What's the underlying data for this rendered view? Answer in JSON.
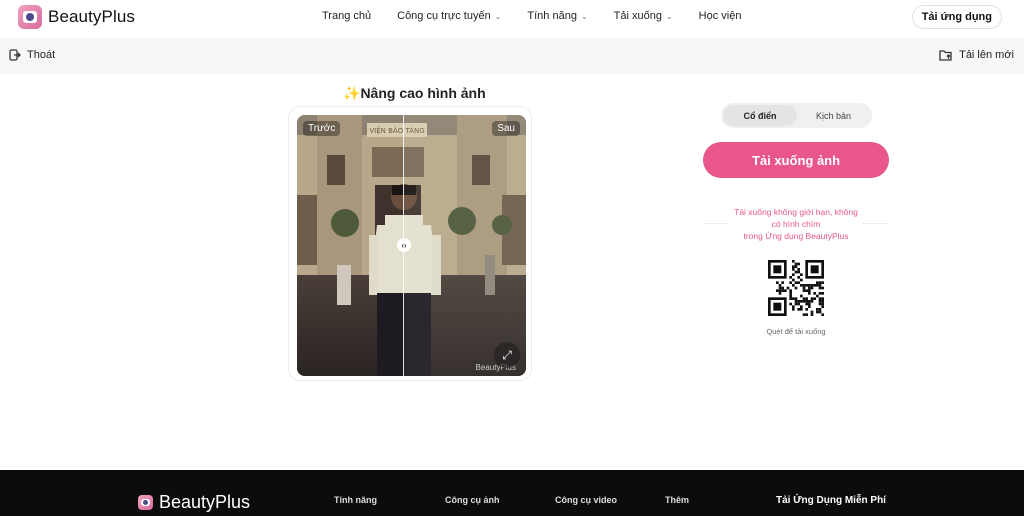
{
  "header": {
    "brand": "BeautyPlus",
    "nav": [
      {
        "label": "Trang chủ",
        "has_dropdown": false
      },
      {
        "label": "Công cụ trực tuyến",
        "has_dropdown": true
      },
      {
        "label": "Tính năng",
        "has_dropdown": true
      },
      {
        "label": "Tải xuống",
        "has_dropdown": true
      },
      {
        "label": "Học viện",
        "has_dropdown": false
      }
    ],
    "app_button": "Tải ứng dụng"
  },
  "subbar": {
    "exit_label": "Thoát",
    "upload_label": "Tải lên mới"
  },
  "editor": {
    "sparkle": "✨",
    "title": "Nâng cao hình ảnh",
    "before_label": "Trước",
    "after_label": "Sau",
    "sign_text": "VIỆN BẢO TÀNG",
    "watermark": "BeautyPlus"
  },
  "panel": {
    "mode_active": "Cổ điển",
    "mode_other": "Kịch bản",
    "download_button": "Tải xuống ảnh",
    "promo_lines": [
      "Tải xuống không giới hạn, không",
      "có hình chìm",
      "trong Ứng dụng BeautyPlus"
    ],
    "qr_caption": "Quét để tải xuống"
  },
  "footer": {
    "brand": "BeautyPlus",
    "columns": [
      "Tính năng",
      "Công cụ ảnh",
      "Công cụ video",
      "Thêm"
    ],
    "app_title": "Tải Ứng Dụng Miễn Phí"
  },
  "colors": {
    "accent": "#e8568b",
    "footer_bg": "#0c0c0c"
  }
}
